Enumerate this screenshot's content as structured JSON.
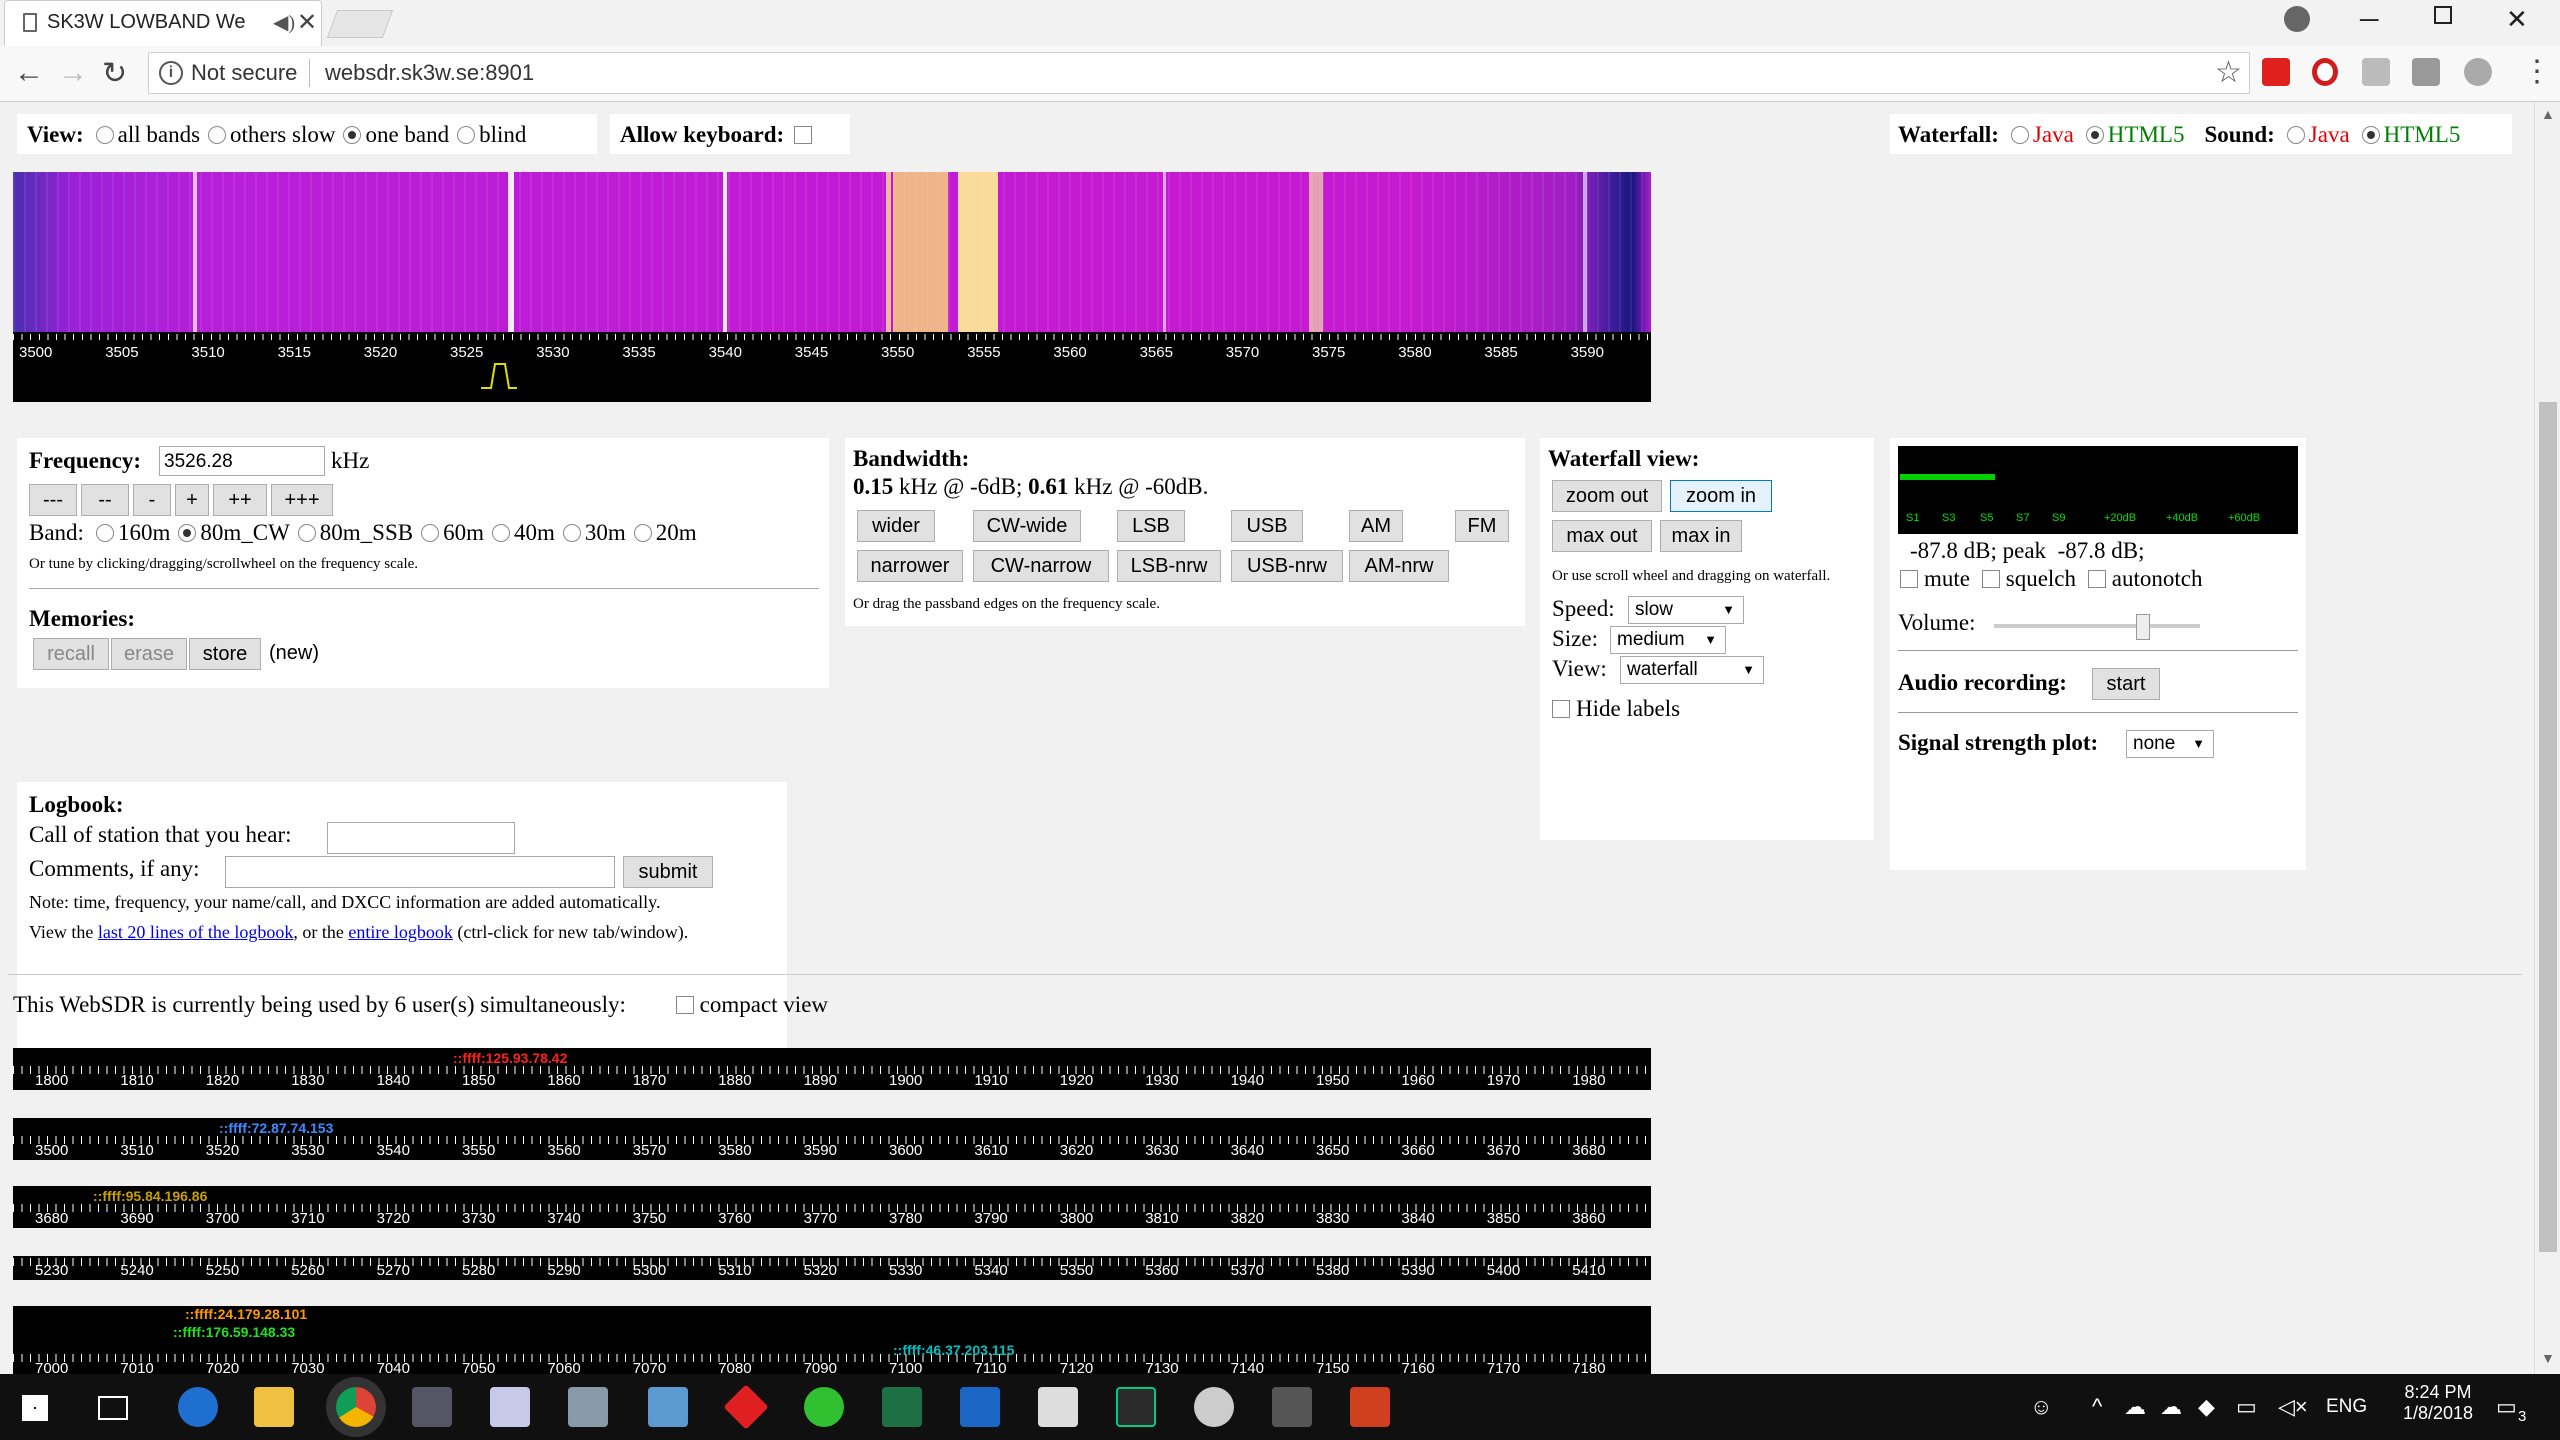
{
  "browser": {
    "tab_title": "SK3W LOWBAND We",
    "tab_audio_icon": "speaker-icon",
    "tab_close": "✕",
    "security_label": "Not secure",
    "url": "websdr.sk3w.se:8901"
  },
  "view_bar": {
    "label": "View:",
    "options": [
      "all bands",
      "others slow",
      "one band",
      "blind"
    ],
    "selected": "one band",
    "keyboard_label": "Allow keyboard:"
  },
  "waterfall_sound": {
    "waterfall_label": "Waterfall:",
    "sound_label": "Sound:",
    "java": "Java",
    "html5": "HTML5",
    "java_color": "#e00000",
    "html5_color": "#008000"
  },
  "main_scale": {
    "labels": [
      "3500",
      "3505",
      "3510",
      "3515",
      "3520",
      "3525",
      "3530",
      "3535",
      "3540",
      "3545",
      "3550",
      "3555",
      "3560",
      "3565",
      "3570",
      "3575",
      "3580",
      "3585",
      "3590"
    ]
  },
  "frequency": {
    "label": "Frequency:",
    "value": "3526.28",
    "unit": "kHz",
    "step_buttons": [
      "---",
      "--",
      "-",
      "+",
      "++",
      "+++"
    ],
    "band_label": "Band:",
    "bands": [
      "160m",
      "80m_CW",
      "80m_SSB",
      "60m",
      "40m",
      "30m",
      "20m"
    ],
    "selected_band": "80m_CW",
    "hint": "Or tune by clicking/dragging/scrollwheel on the frequency scale.",
    "memories_label": "Memories:",
    "memory_buttons": [
      "recall",
      "erase",
      "store"
    ],
    "memory_new": "(new)"
  },
  "bandwidth": {
    "label": "Bandwidth:",
    "bw1": "0.15",
    "bw1_text": "kHz @ -6dB;",
    "bw2": "0.61",
    "bw2_text": "kHz @ -60dB.",
    "row1": [
      "wider",
      "CW-wide",
      "LSB",
      "USB",
      "AM",
      "FM"
    ],
    "row2": [
      "narrower",
      "CW-narrow",
      "LSB-nrw",
      "USB-nrw",
      "AM-nrw"
    ],
    "hint": "Or drag the passband edges on the frequency scale."
  },
  "waterfall_view": {
    "label": "Waterfall view:",
    "buttons": [
      "zoom out",
      "zoom in",
      "max out",
      "max in"
    ],
    "hint": "Or use scroll wheel and dragging on waterfall.",
    "speed_label": "Speed:",
    "speed_value": "slow",
    "size_label": "Size:",
    "size_value": "medium",
    "view_label": "View:",
    "view_value": "waterfall",
    "hide_labels": "Hide labels"
  },
  "smeter": {
    "scale": [
      "S1",
      "S3",
      "S5",
      "S7",
      "S9",
      "+20dB",
      "+40dB",
      "+60dB"
    ],
    "level_text": "-87.8 dB; peak",
    "peak_text": "-87.8 dB;",
    "level_fraction": 0.24,
    "mute": "mute",
    "squelch": "squelch",
    "autonotch": "autonotch",
    "volume_label": "Volume:",
    "volume_fraction": 0.74,
    "recording_label": "Audio recording:",
    "recording_button": "start",
    "plot_label": "Signal strength plot:",
    "plot_value": "none"
  },
  "logbook": {
    "label": "Logbook:",
    "call_label": "Call of station that you hear:",
    "comments_label": "Comments, if any:",
    "submit": "submit",
    "note": "Note: time, frequency, your name/call, and DXCC information are added automatically.",
    "view_prefix": "View the",
    "link1": "last 20 lines of the logbook",
    "view_mid": ", or the",
    "link2": "entire logbook",
    "view_suffix": "(ctrl-click for new tab/window)."
  },
  "users": {
    "text": "This WebSDR is currently being used by 6 user(s) simultaneously:",
    "compact": "compact view",
    "bands": [
      {
        "labels": [
          "1800",
          "1810",
          "1820",
          "1830",
          "1840",
          "1850",
          "1860",
          "1870",
          "1880",
          "1890",
          "1900",
          "1910",
          "1920",
          "1930",
          "1940",
          "1950",
          "1960",
          "1970",
          "1980"
        ],
        "users": [
          {
            "ip": "::ffff:125.93.78.42",
            "color": "#ff2020"
          }
        ]
      },
      {
        "labels": [
          "3500",
          "3510",
          "3520",
          "3530",
          "3540",
          "3550",
          "3560",
          "3570",
          "3580",
          "3590",
          "3600",
          "3610",
          "3620",
          "3630",
          "3640",
          "3650",
          "3660",
          "3670",
          "3680"
        ],
        "users": [
          {
            "ip": "::ffff:72.87.74.153",
            "color": "#3c8cff"
          }
        ]
      },
      {
        "labels": [
          "3680",
          "3690",
          "3700",
          "3710",
          "3720",
          "3730",
          "3740",
          "3750",
          "3760",
          "3770",
          "3780",
          "3790",
          "3800",
          "3810",
          "3820",
          "3830",
          "3840",
          "3850",
          "3860"
        ],
        "users": [
          {
            "ip": "::ffff:95.84.196.86",
            "color": "#c8a000"
          }
        ]
      },
      {
        "labels": [
          "5230",
          "5240",
          "5250",
          "5260",
          "5270",
          "5280",
          "5290",
          "5300",
          "5310",
          "5320",
          "5330",
          "5340",
          "5350",
          "5360",
          "5370",
          "5380",
          "5390",
          "5400",
          "5410"
        ],
        "users": []
      },
      {
        "labels": [
          "7000",
          "7010",
          "7020",
          "7030",
          "7040",
          "7050",
          "7060",
          "7070",
          "7080",
          "7090",
          "7100",
          "7110",
          "7120",
          "7130",
          "7140",
          "7150",
          "7160",
          "7170",
          "7180"
        ],
        "users": [
          {
            "ip": "::ffff:24.179.28.101",
            "color": "#ff9900"
          },
          {
            "ip": "::ffff:176.59.148.33",
            "color": "#20e020"
          },
          {
            "ip": "::ffff:46.37.203.115",
            "color": "#00c0c0"
          }
        ]
      }
    ]
  },
  "taskbar": {
    "time": "8:24 PM",
    "date": "1/8/2018",
    "lang": "ENG",
    "notifications": "3"
  }
}
